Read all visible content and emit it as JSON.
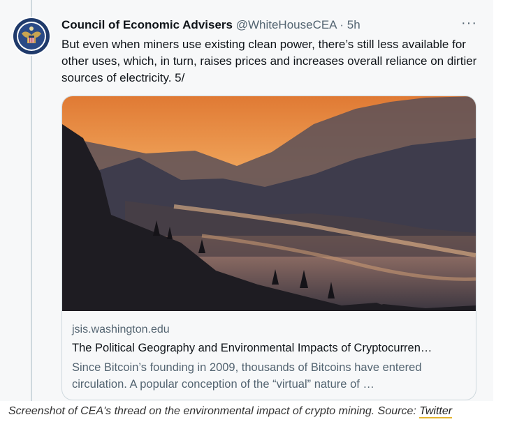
{
  "tweet": {
    "display_name": "Council of Economic Advisers",
    "handle": "@WhiteHouseCEA",
    "separator": "·",
    "time": "5h",
    "more_icon": "more-horizontal-icon",
    "text": "But even when miners use existing clean power, there’s still less available for other uses, which, in turn, raises prices and increases overall reliance on dirtier sources of electricity. 5/"
  },
  "card": {
    "domain": "jsis.washington.edu",
    "title": "The Political Geography and Environmental Impacts of Cryptocurren…",
    "description": "Since Bitcoin’s founding in 2009, thousands of Bitcoins have entered circulation. A popular conception of the “virtual” nature of …"
  },
  "caption": {
    "text": "Screenshot of CEA's thread on the environmental impact of crypto mining. Source: ",
    "link": "Twitter",
    "link_underline_color": "#e5b52f"
  }
}
